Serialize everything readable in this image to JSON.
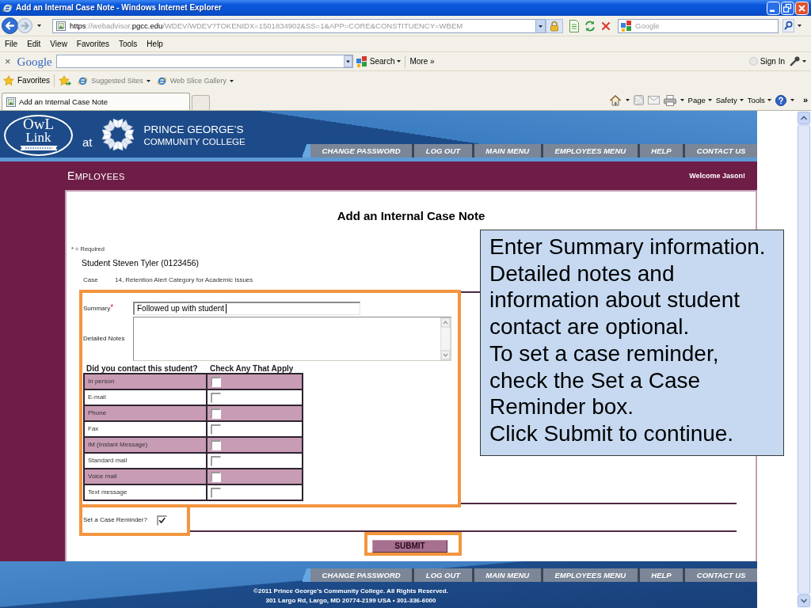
{
  "window": {
    "title": "Add an Internal Case Note - Windows Internet Explorer"
  },
  "address_bar": {
    "url_parts": [
      {
        "text": "https",
        "dim": false
      },
      {
        "text": "://webadvisor.",
        "dim": true
      },
      {
        "text": "pgcc.edu",
        "dim": false
      },
      {
        "text": "/WDEV/WDEV?TOKENIDX=1501834902&SS=1&APP=CORE&CONSTITUENCY=WBEM",
        "dim": true
      }
    ]
  },
  "search_box": {
    "placeholder": "Google"
  },
  "menu_bar": [
    "File",
    "Edit",
    "View",
    "Favorites",
    "Tools",
    "Help"
  ],
  "google_toolbar": {
    "close": "×",
    "logo": "Google",
    "search_button": "Search",
    "more": "More »",
    "sign_in": "Sign In"
  },
  "favorites_bar": {
    "favorites": "Favorites",
    "links": [
      "Suggested Sites",
      "Web Slice Gallery"
    ]
  },
  "tabs": [
    {
      "label": "Add an Internal Case Note",
      "selected": true
    }
  ],
  "command_bar": {
    "menus": [
      "Page",
      "Safety",
      "Tools"
    ],
    "overflow": "»"
  },
  "site_header": {
    "logo": [
      "OwL",
      "Link"
    ],
    "at": "at",
    "college": [
      "PRINCE GEORGE’S",
      "COMMUNITY COLLEGE"
    ],
    "nav": [
      "CHANGE PASSWORD",
      "LOG OUT",
      "MAIN MENU",
      "EMPLOYEES MENU",
      "HELP",
      "CONTACT US"
    ]
  },
  "section_bar": {
    "title": "EMPLOYEES",
    "welcome": "Welcome Jason!"
  },
  "form": {
    "heading": "Add an Internal Case Note",
    "required_note": "* = Required",
    "student": "Student Steven Tyler (0123456)",
    "case": {
      "label": "Case",
      "value": "14, Retention Alert Category for Academic Issues"
    },
    "summary": {
      "label": "Summary",
      "required_mark": "*",
      "value": "Followed up with student"
    },
    "notes": {
      "label": "Detailed Notes"
    },
    "contact": {
      "columns": [
        "Did you contact this student?",
        "Check Any That Apply"
      ],
      "rows": [
        {
          "method": "In person",
          "checked": false
        },
        {
          "method": "E-mail",
          "checked": false
        },
        {
          "method": "Phone",
          "checked": false
        },
        {
          "method": "Fax",
          "checked": false
        },
        {
          "method": "IM (Instant Message)",
          "checked": false
        },
        {
          "method": "Standard mail",
          "checked": false
        },
        {
          "method": "Voice mail",
          "checked": false
        },
        {
          "method": "Text message",
          "checked": false
        }
      ]
    },
    "reminder": {
      "label": "Set a Case Reminder?",
      "checked": true
    },
    "submit": "SUBMIT"
  },
  "footer": {
    "nav": [
      "CHANGE PASSWORD",
      "LOG OUT",
      "MAIN MENU",
      "EMPLOYEES MENU",
      "HELP",
      "CONTACT US"
    ],
    "copyright": "©2011 Prince George’s Community College. All Rights Reserved.",
    "address": "301 Largo Rd, Largo, MD 20774-2199 USA • 301-336-6000"
  },
  "callout": {
    "paragraphs": [
      "Enter Summary information. Detailed notes and information about student contact are optional.",
      "To set a case reminder, check the Set a Case Reminder box.",
      "Click Submit to continue."
    ]
  }
}
